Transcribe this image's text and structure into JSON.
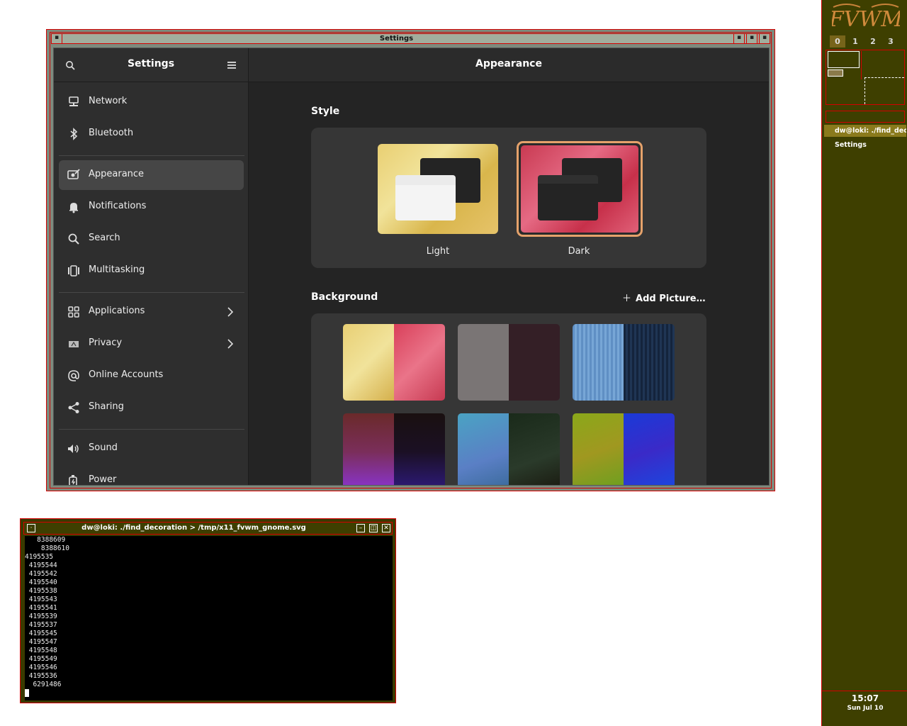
{
  "settings_window": {
    "frame_title": "Settings",
    "sidebar_title": "Settings",
    "main_title": "Appearance",
    "nav_items": [
      {
        "label": "Network",
        "icon": "network-icon"
      },
      {
        "label": "Bluetooth",
        "icon": "bluetooth-icon"
      },
      {
        "label": "Appearance",
        "icon": "appearance-icon",
        "active": true
      },
      {
        "label": "Notifications",
        "icon": "bell-icon"
      },
      {
        "label": "Search",
        "icon": "search-icon"
      },
      {
        "label": "Multitasking",
        "icon": "multitasking-icon"
      },
      {
        "label": "Applications",
        "icon": "apps-grid-icon",
        "has_submenu": true
      },
      {
        "label": "Privacy",
        "icon": "hand-icon",
        "has_submenu": true
      },
      {
        "label": "Online Accounts",
        "icon": "at-icon"
      },
      {
        "label": "Sharing",
        "icon": "share-icon"
      },
      {
        "label": "Sound",
        "icon": "speaker-icon"
      },
      {
        "label": "Power",
        "icon": "power-icon"
      }
    ],
    "style_section": {
      "title": "Style",
      "options": [
        {
          "label": "Light",
          "selected": false
        },
        {
          "label": "Dark",
          "selected": true
        }
      ]
    },
    "background_section": {
      "title": "Background",
      "add_picture_label": "Add Picture…"
    }
  },
  "terminal_window": {
    "title": "dw@loki: ./find_decoration > /tmp/x11_fvwm_gnome.svg",
    "lines": [
      "   8388609",
      "    8388610",
      "4195535",
      " 4195544",
      " 4195542",
      " 4195540",
      " 4195538",
      " 4195543",
      " 4195541",
      " 4195539",
      " 4195537",
      " 4195545",
      " 4195547",
      " 4195548",
      " 4195549",
      " 4195546",
      " 4195536",
      "  6291486"
    ]
  },
  "panel": {
    "logo_text": "FVWM",
    "desks": [
      "0",
      "1",
      "2",
      "3"
    ],
    "active_desk": "0",
    "tasks": [
      {
        "label": "dw@loki: ./find_deco",
        "active": true
      },
      {
        "label": "Settings",
        "active": false
      }
    ],
    "clock_time": "15:07",
    "clock_date": "Sun Jul 10"
  },
  "colors": {
    "accent": "#e5a26b",
    "frame_border": "#d40000",
    "panel_bg": "#3e3f00"
  }
}
